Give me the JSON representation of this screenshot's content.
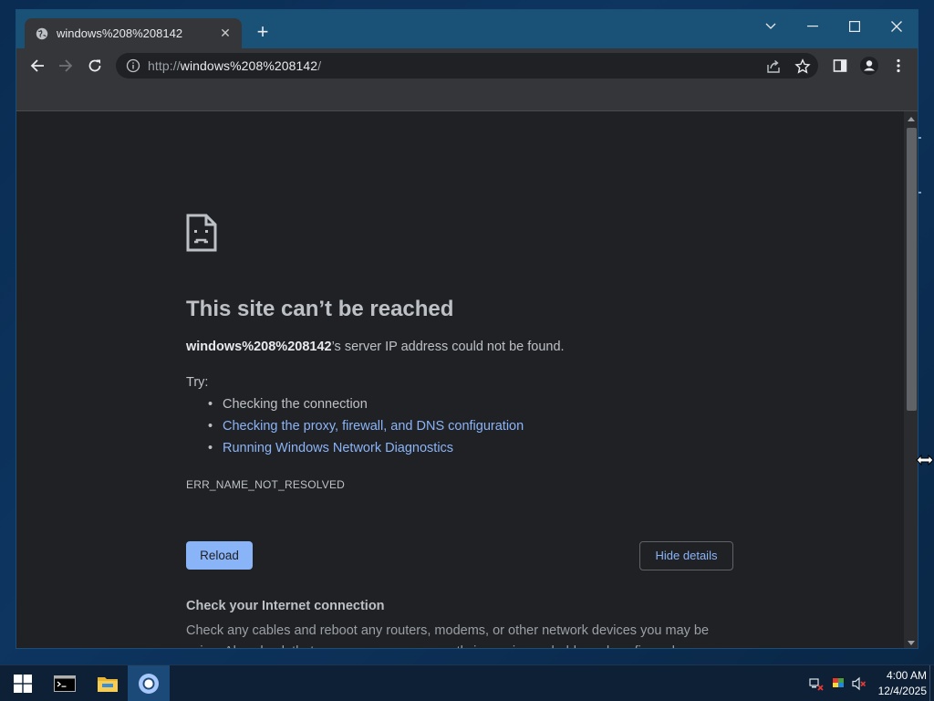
{
  "browser": {
    "tab": {
      "title": "windows%208%208142",
      "favicon": "globe-icon",
      "close": "✕"
    },
    "new_tab": "+",
    "window_controls": [
      "chevron-down-icon",
      "minimize-icon",
      "maximize-icon",
      "close-icon"
    ],
    "address": {
      "scheme": "http://",
      "host": "windows%208%208142",
      "path": "/"
    }
  },
  "page": {
    "title": "This site can’t be reached",
    "subtitle_host": "windows%208%208142",
    "subtitle_rest": "’s server IP address could not be found.",
    "try_label": "Try:",
    "suggestions": [
      "Checking the connection",
      "Checking the proxy, firewall, and DNS configuration",
      "Running Windows Network Diagnostics"
    ],
    "error_code": "ERR_NAME_NOT_RESOLVED",
    "reload_label": "Reload",
    "hide_details_label": "Hide details",
    "check_title": "Check your Internet connection",
    "check_text": "Check any cables and reboot any routers, modems, or other network devices you may be using. Also check that any proxy server currently in use is reachable and configured."
  },
  "taskbar": {
    "apps": [
      "windows-start-icon",
      "terminal-icon",
      "file-explorer-icon",
      "chrome-icon"
    ],
    "clock_time": "4:00 AM",
    "clock_date": "12/4/2025"
  },
  "colors": {
    "page_bg": "#202124",
    "toolbar_bg": "#35363a",
    "link": "#8ab4f8",
    "titlebar": "#1a5277",
    "taskbar": "#0d2036"
  }
}
